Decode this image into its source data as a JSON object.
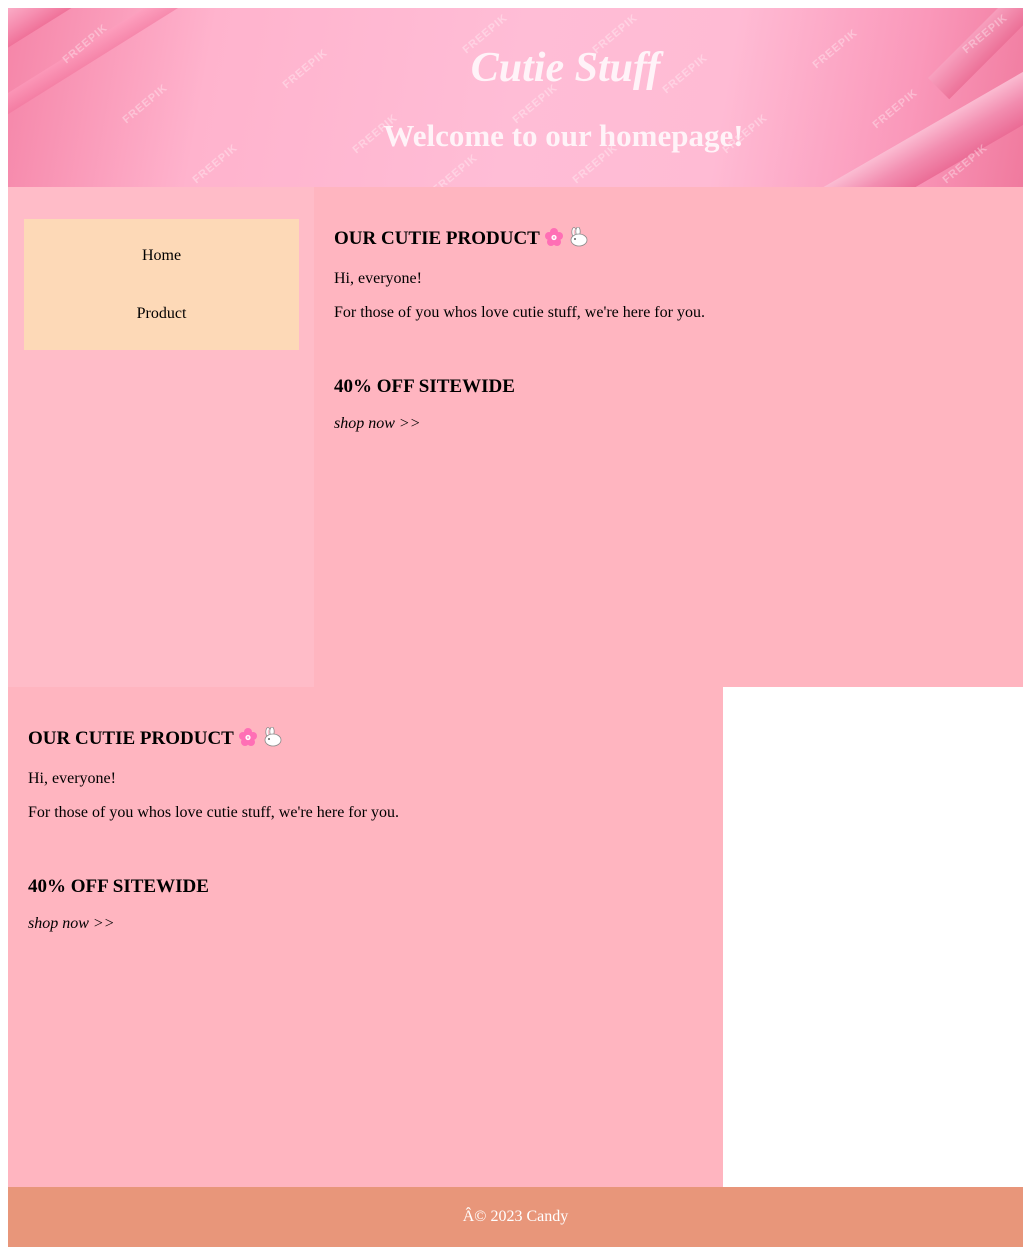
{
  "header": {
    "title": "Cutie Stuff",
    "subtitle": "Welcome to our homepage!",
    "watermark": "FREEPIK"
  },
  "nav": {
    "items": [
      {
        "label": "Home"
      },
      {
        "label": "Product"
      }
    ]
  },
  "sections": [
    {
      "heading": "OUR CUTIE PRODUCT",
      "greeting": "Hi, everyone!",
      "text": "For those of you whos love cutie stuff, we're here for you.",
      "promo": "40% OFF SITEWIDE",
      "cta": "shop now >>"
    },
    {
      "heading": "OUR CUTIE PRODUCT",
      "greeting": "Hi, everyone!",
      "text": "For those of you whos love cutie stuff, we're here for you.",
      "promo": "40% OFF SITEWIDE",
      "cta": "shop now >>"
    }
  ],
  "icons": [
    "cherry-blossom-icon",
    "rabbit-icon"
  ],
  "colors": {
    "sidebar_bg": "#ffbcc8",
    "main_bg": "#ffb5c0",
    "nav_bg": "#fdd9b7",
    "footer_bg": "#e8967a"
  },
  "footer": {
    "text": "Â© 2023 Candy"
  }
}
